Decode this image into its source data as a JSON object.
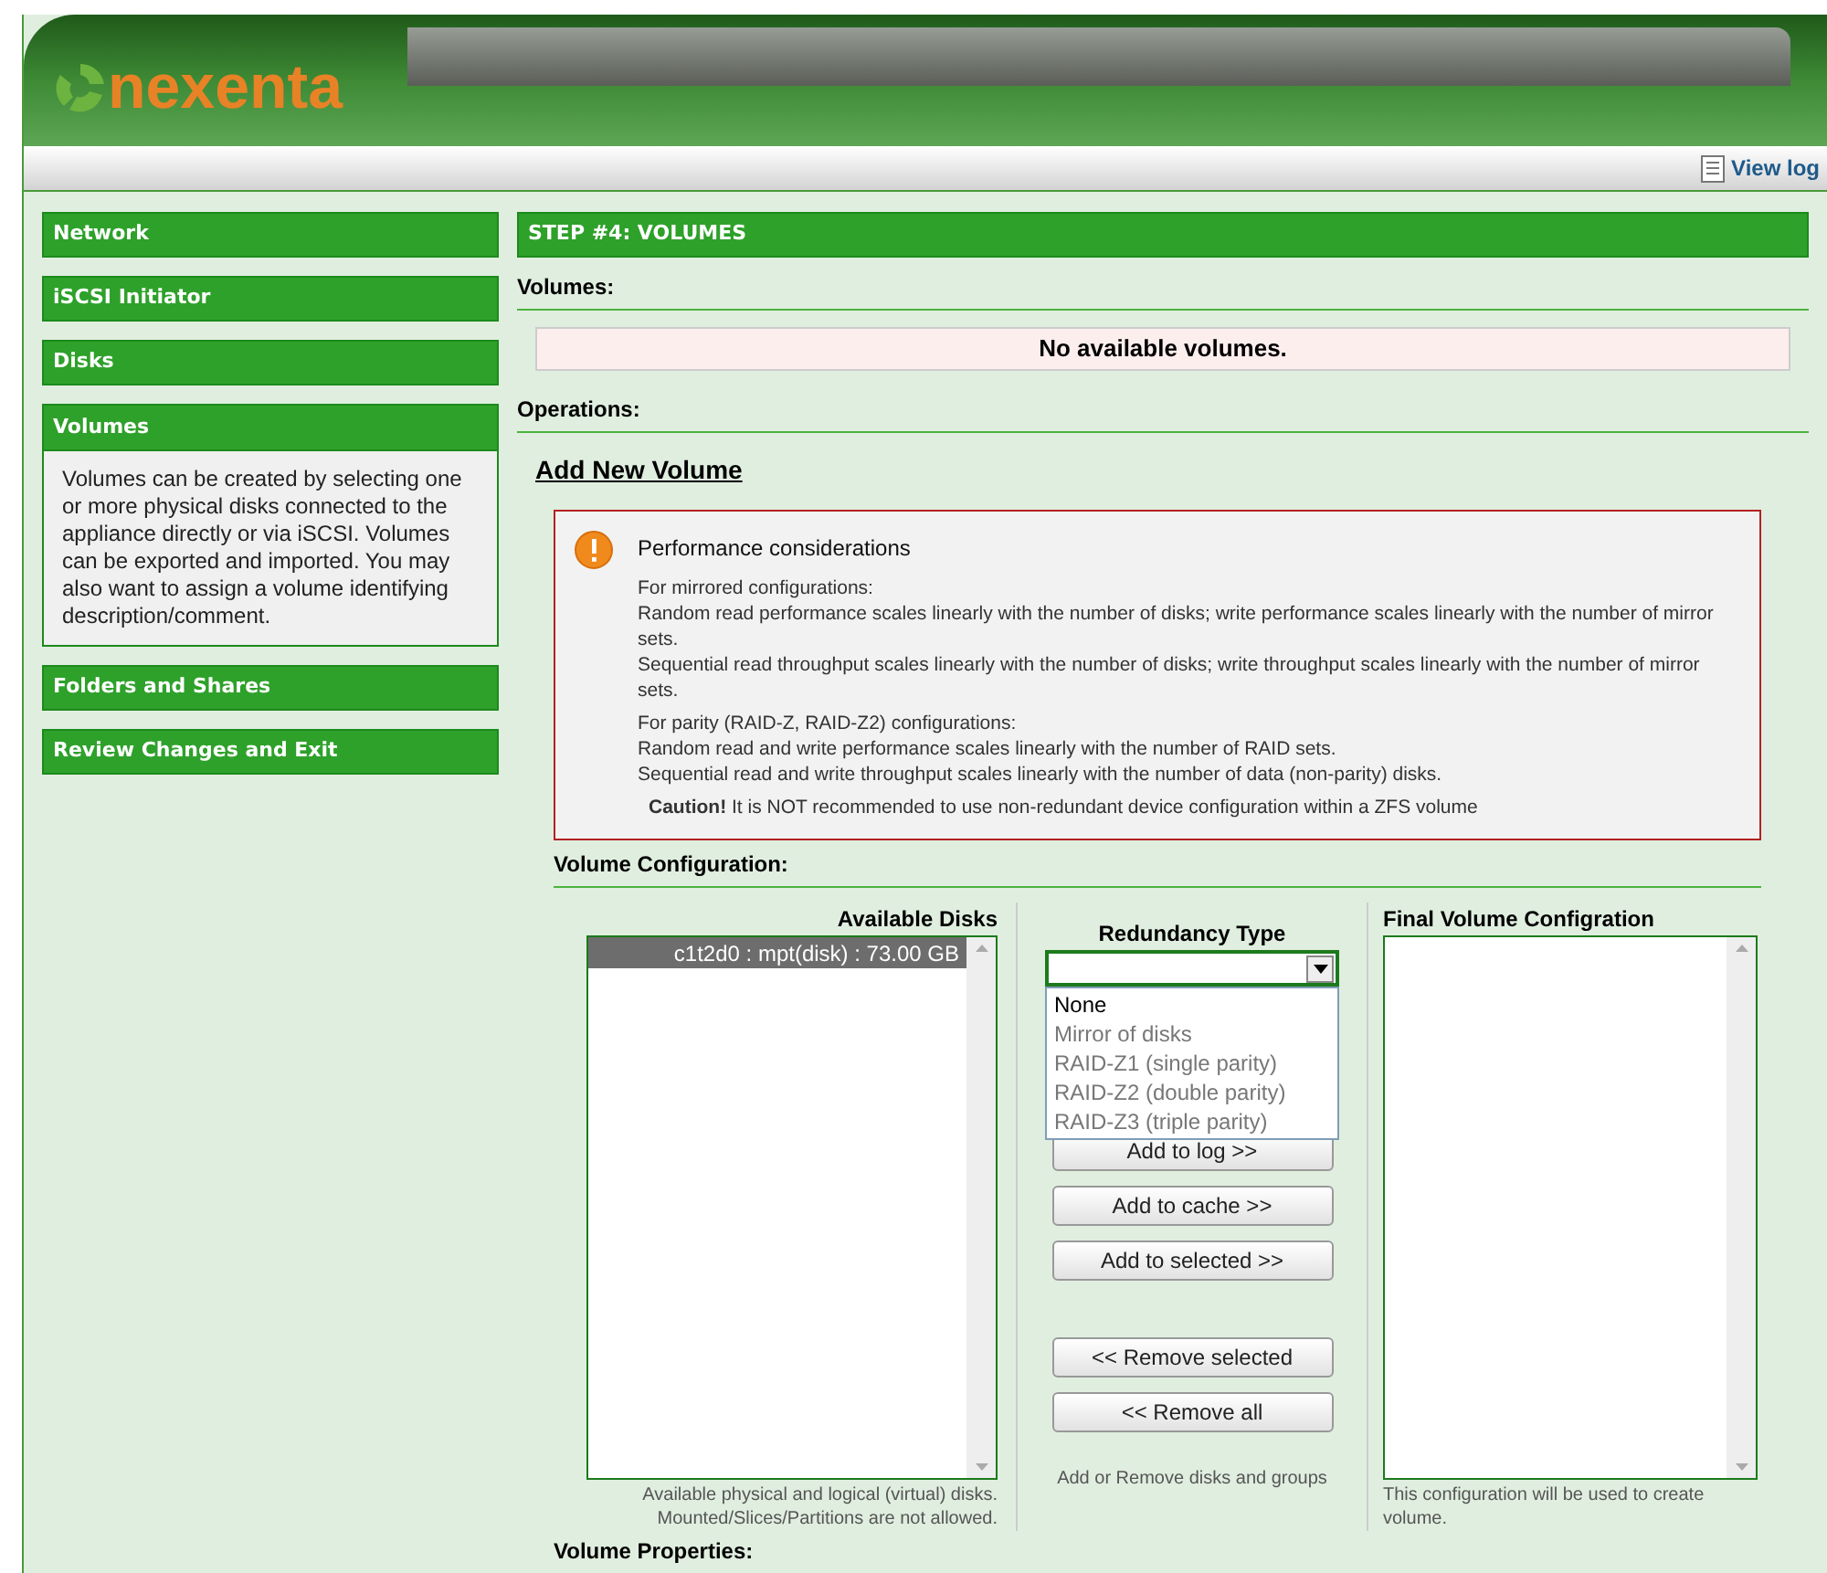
{
  "header": {
    "logo_text": "nexenta"
  },
  "toolbar": {
    "view_log": "View log"
  },
  "sidebar": {
    "items": [
      {
        "label": "Network",
        "expanded": false
      },
      {
        "label": "iSCSI Initiator",
        "expanded": false
      },
      {
        "label": "Disks",
        "expanded": false
      },
      {
        "label": "Volumes",
        "expanded": true,
        "description": "Volumes can be created by selecting one or more physical disks connected to the appliance directly or via iSCSI. Volumes can be exported and imported. You may also want to assign a volume identifying description/comment."
      },
      {
        "label": "Folders and Shares",
        "expanded": false
      },
      {
        "label": "Review Changes and Exit",
        "expanded": false
      }
    ]
  },
  "main": {
    "step_title": "STEP #4: VOLUMES",
    "volumes_heading": "Volumes:",
    "volumes_message": "No available volumes.",
    "operations_heading": "Operations:",
    "add_new_volume": "Add New Volume",
    "warning": {
      "title": "Performance considerations",
      "groups": [
        [
          "For mirrored configurations:",
          "Random read performance scales linearly with the number of disks; write performance scales linearly with the number of mirror sets.",
          "Sequential read throughput scales linearly with the number of disks; write throughput scales linearly with the number of mirror sets."
        ],
        [
          "For parity (RAID-Z, RAID-Z2) configurations:",
          "Random read and write performance scales linearly with the number of RAID sets.",
          "Sequential read and write throughput scales linearly with the number of data (non-parity) disks."
        ]
      ],
      "caution": "**Caution!** It is NOT recommended to use non-redundant device configuration within a ZFS volume"
    },
    "volume_configuration_heading": "Volume Configuration:",
    "available_disks": {
      "title": "Available Disks",
      "items": [
        {
          "label": "c1t2d0 : mpt(disk) : 73.00 GB",
          "selected": true
        }
      ],
      "note": "Available physical and logical (virtual) disks. Mounted/Slices/Partitions are not allowed."
    },
    "redundancy": {
      "title": "Redundancy Type",
      "expanded": true,
      "options": [
        {
          "label": "None",
          "selected": true
        },
        {
          "label": "Mirror of disks",
          "selected": false
        },
        {
          "label": "RAID-Z1 (single parity)",
          "selected": false
        },
        {
          "label": "RAID-Z2 (double parity)",
          "selected": false
        },
        {
          "label": "RAID-Z3 (triple parity)",
          "selected": false
        }
      ]
    },
    "add_buttons": [
      "Add to log >>",
      "Add to cache >>",
      "Add to selected >>"
    ],
    "remove_buttons": [
      "<< Remove selected",
      "<< Remove all"
    ],
    "middle_note": "Add or Remove disks and groups",
    "final": {
      "title": "Final Volume Configration",
      "note": "This configuration will be used to create volume."
    },
    "volume_properties_heading": "Volume Properties:"
  }
}
